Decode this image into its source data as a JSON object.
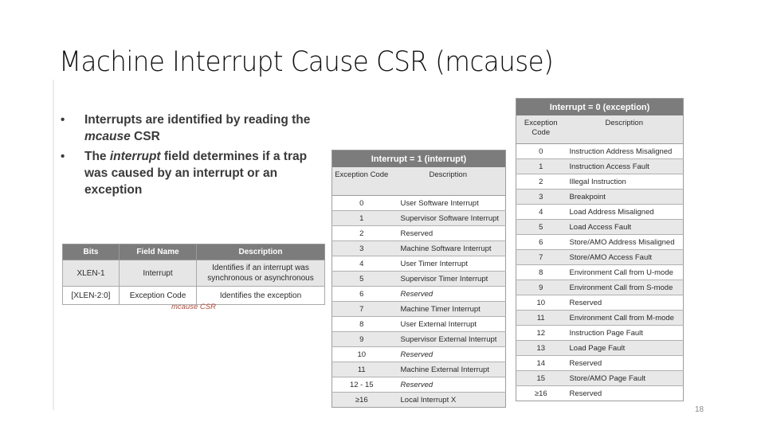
{
  "slide": {
    "title": "Machine Interrupt Cause CSR (mcause)",
    "page_number": "18"
  },
  "bullets": [
    {
      "parts": [
        {
          "text": "Interrupts are identified by reading the ",
          "italic": false
        },
        {
          "text": "mcause",
          "italic": true
        },
        {
          "text": " CSR",
          "italic": false
        }
      ]
    },
    {
      "parts": [
        {
          "text": "The ",
          "italic": false
        },
        {
          "text": "interrupt",
          "italic": true
        },
        {
          "text": " field determines if a trap was caused by an interrupt or an exception",
          "italic": false
        }
      ]
    }
  ],
  "csr_table": {
    "headers": [
      "Bits",
      "Field Name",
      "Description"
    ],
    "rows": [
      [
        "XLEN-1",
        "Interrupt",
        "Identifies if an interrupt was synchronous or asynchronous"
      ],
      [
        "[XLEN-2:0]",
        "Exception Code",
        "Identifies the exception"
      ]
    ],
    "caption": "mcause CSR"
  },
  "interrupt_table": {
    "title": "Interrupt = 1 (interrupt)",
    "headers": [
      "Exception Code",
      "Description"
    ],
    "rows": [
      {
        "code": "0",
        "desc": "User Software Interrupt",
        "italic": false
      },
      {
        "code": "1",
        "desc": "Supervisor Software Interrupt",
        "italic": false
      },
      {
        "code": "2",
        "desc": "Reserved",
        "italic": false
      },
      {
        "code": "3",
        "desc": "Machine Software Interrupt",
        "italic": false
      },
      {
        "code": "4",
        "desc": "User Timer Interrupt",
        "italic": false
      },
      {
        "code": "5",
        "desc": "Supervisor Timer Interrupt",
        "italic": false
      },
      {
        "code": "6",
        "desc": "Reserved",
        "italic": true
      },
      {
        "code": "7",
        "desc": "Machine Timer Interrupt",
        "italic": false
      },
      {
        "code": "8",
        "desc": "User External Interrupt",
        "italic": false
      },
      {
        "code": "9",
        "desc": "Supervisor External Interrupt",
        "italic": false
      },
      {
        "code": "10",
        "desc": "Reserved",
        "italic": true
      },
      {
        "code": "11",
        "desc": "Machine External Interrupt",
        "italic": false
      },
      {
        "code": "12 - 15",
        "desc": "Reserved",
        "italic": true
      },
      {
        "code": "≥16",
        "desc": "Local Interrupt  X",
        "italic": false
      }
    ]
  },
  "exception_table": {
    "title": "Interrupt = 0 (exception)",
    "headers": [
      "Exception Code",
      "Description"
    ],
    "rows": [
      {
        "code": "0",
        "desc": "Instruction Address Misaligned",
        "italic": false
      },
      {
        "code": "1",
        "desc": "Instruction Access Fault",
        "italic": false
      },
      {
        "code": "2",
        "desc": "Illegal Instruction",
        "italic": false
      },
      {
        "code": "3",
        "desc": "Breakpoint",
        "italic": false
      },
      {
        "code": "4",
        "desc": "Load Address Misaligned",
        "italic": false
      },
      {
        "code": "5",
        "desc": "Load Access Fault",
        "italic": false
      },
      {
        "code": "6",
        "desc": "Store/AMO Address Misaligned",
        "italic": false
      },
      {
        "code": "7",
        "desc": "Store/AMO Access Fault",
        "italic": false
      },
      {
        "code": "8",
        "desc": "Environment Call from U-mode",
        "italic": false
      },
      {
        "code": "9",
        "desc": "Environment Call from S-mode",
        "italic": false
      },
      {
        "code": "10",
        "desc": "Reserved",
        "italic": false
      },
      {
        "code": "11",
        "desc": "Environment Call from M-mode",
        "italic": false
      },
      {
        "code": "12",
        "desc": "Instruction Page Fault",
        "italic": false
      },
      {
        "code": "13",
        "desc": "Load Page Fault",
        "italic": false
      },
      {
        "code": "14",
        "desc": "Reserved",
        "italic": false
      },
      {
        "code": "15",
        "desc": "Store/AMO Page Fault",
        "italic": false
      },
      {
        "code": "≥16",
        "desc": "Reserved",
        "italic": false
      }
    ]
  },
  "colors": {
    "table_header": "#7c7c7c",
    "row_band": "#e8e8e8",
    "caption": "#b54a3a"
  }
}
